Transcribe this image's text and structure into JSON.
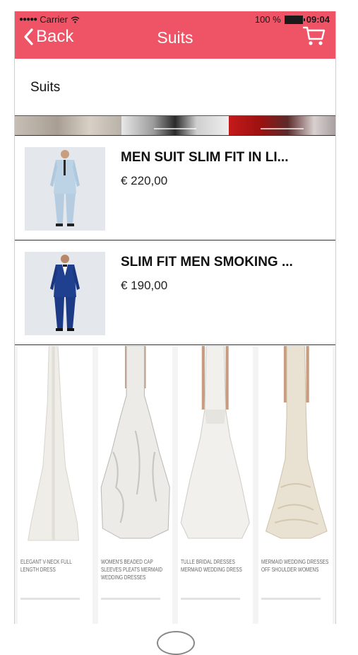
{
  "status_bar": {
    "carrier": "Carrier",
    "battery": "100 %",
    "time": "09:04"
  },
  "nav": {
    "back_label": "Back",
    "title": "Suits"
  },
  "category": {
    "title": "Suits"
  },
  "products": [
    {
      "name": "MEN SUIT SLIM FIT IN LI...",
      "price": "€ 220,00"
    },
    {
      "name": "SLIM FIT MEN SMOKING ...",
      "price": "€ 190,00"
    }
  ],
  "dresses": [
    {
      "name": "ELEGANT V-NECK FULL LENGTH DRESS"
    },
    {
      "name": "WOMEN'S BEADED CAP SLEEVES PLEATS MERMAID WEDDING DRESSES"
    },
    {
      "name": "TULLE BRIDAL DRESSES MERMAID WEDDING DRESS"
    },
    {
      "name": "MERMAID WEDDING DRESSES OFF SHOULDER WOMENS"
    }
  ],
  "colors": {
    "header": "#ee5466",
    "text": "#111111"
  }
}
